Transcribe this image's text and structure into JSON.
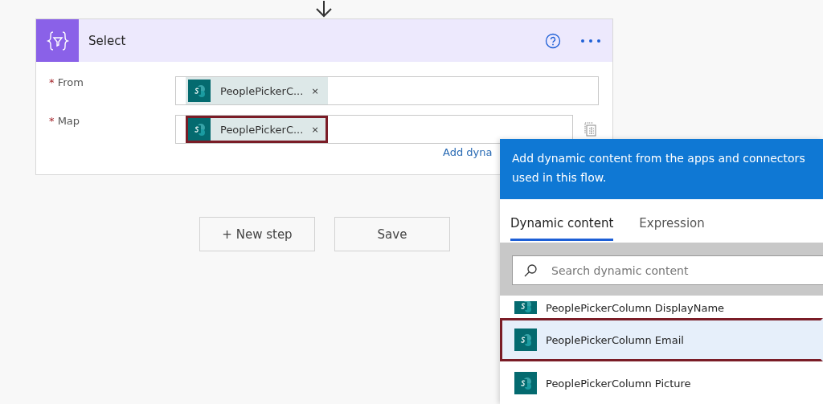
{
  "action": {
    "title": "Select",
    "fields": [
      {
        "label": "From",
        "required_mark": "*",
        "token": "PeoplePickerC...",
        "remove": "×",
        "highlighted": false,
        "copy_icon": false
      },
      {
        "label": "Map",
        "required_mark": "*",
        "token": "PeoplePickerC...",
        "remove": "×",
        "highlighted": true,
        "copy_icon": true
      }
    ],
    "link": "Add dyna"
  },
  "buttons": [
    "+ New step",
    "Save"
  ],
  "dynamic_panel": {
    "message": "Add dynamic content from the apps and connectors used in this flow.",
    "tabs": [
      {
        "label": "Dynamic content",
        "selected": true
      },
      {
        "label": "Expression",
        "selected": false
      }
    ],
    "search": {
      "placeholder": "Search dynamic content"
    },
    "items": [
      {
        "label": "PeoplePickerColumn DisplayName",
        "selected": false
      },
      {
        "label": "PeoplePickerColumn Email",
        "selected": true
      },
      {
        "label": "PeoplePickerColumn Picture",
        "selected": false
      }
    ]
  }
}
